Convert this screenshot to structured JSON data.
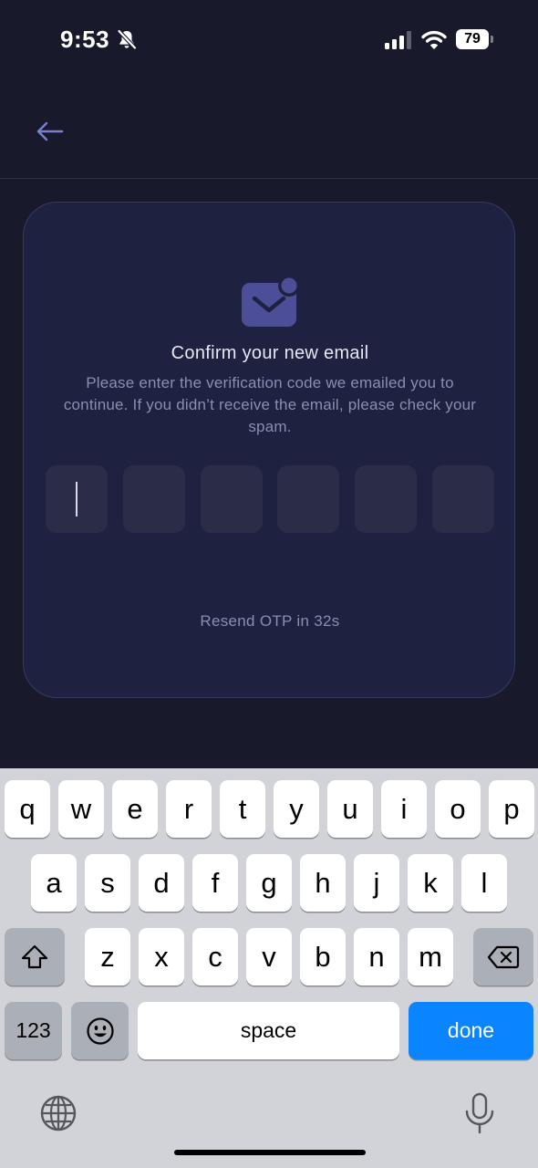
{
  "status_bar": {
    "time": "9:53",
    "battery": "79",
    "icons": [
      "bell-slash-icon",
      "cellular-signal-icon",
      "wifi-icon",
      "battery-icon"
    ]
  },
  "header": {
    "back_icon": "arrow-left-icon"
  },
  "card": {
    "icon": "envelope-notification-icon",
    "title": "Confirm your new email",
    "description": "Please enter the verification code we emailed you to continue. If you didn’t receive the email, please check your spam.",
    "otp_digits": [
      "",
      "",
      "",
      "",
      "",
      ""
    ],
    "resend_text": "Resend OTP in 32s"
  },
  "keyboard": {
    "row1": [
      "q",
      "w",
      "e",
      "r",
      "t",
      "y",
      "u",
      "i",
      "o",
      "p"
    ],
    "row2": [
      "a",
      "s",
      "d",
      "f",
      "g",
      "h",
      "j",
      "k",
      "l"
    ],
    "row3": [
      "z",
      "x",
      "c",
      "v",
      "b",
      "n",
      "m"
    ],
    "numbers_label": "123",
    "space_label": "space",
    "done_label": "done",
    "icons": [
      "shift-icon",
      "delete-icon",
      "emoji-icon",
      "globe-icon",
      "microphone-icon"
    ]
  },
  "colors": {
    "background": "#181a2c",
    "card": "#1f2140",
    "otp_box": "#2b2d48",
    "accent": "#4c4f98",
    "done_key": "#0a84ff"
  }
}
